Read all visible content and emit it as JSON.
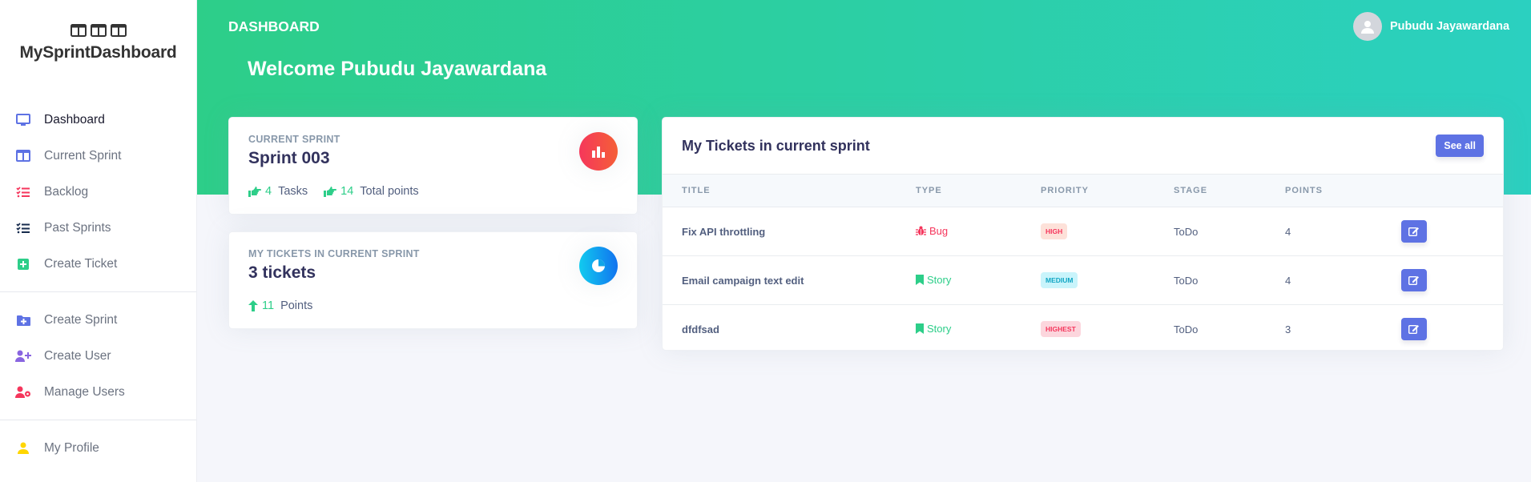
{
  "brand": {
    "name": "MySprintDashboard"
  },
  "sidebar": {
    "items": [
      {
        "label": "Dashboard",
        "icon": "monitor-icon",
        "color": "#5e72e4",
        "active": true
      },
      {
        "label": "Current Sprint",
        "icon": "columns-icon",
        "color": "#5e72e4"
      },
      {
        "label": "Backlog",
        "icon": "tasks-icon",
        "color": "#f5365c"
      },
      {
        "label": "Past Sprints",
        "icon": "list-check-icon",
        "color": "#172b4d"
      },
      {
        "label": "Create Ticket",
        "icon": "plus-square-icon",
        "color": "#2dce89"
      },
      {
        "label": "Create Sprint",
        "icon": "folder-plus-icon",
        "color": "#5e72e4"
      },
      {
        "label": "Create User",
        "icon": "user-plus-icon",
        "color": "#8965e0"
      },
      {
        "label": "Manage Users",
        "icon": "user-cog-icon",
        "color": "#f5365c"
      },
      {
        "label": "My Profile",
        "icon": "user-icon",
        "color": "#ffd600"
      }
    ]
  },
  "header": {
    "title": "DASHBOARD",
    "welcome": "Welcome Pubudu Jayawardana",
    "user_name": "Pubudu Jayawardana"
  },
  "stats": {
    "current_sprint": {
      "label": "Current Sprint",
      "value": "Sprint 003",
      "tasks_count": "4",
      "tasks_label": "Tasks",
      "points_count": "14",
      "points_label": "Total points",
      "icon": "chart-bar-icon",
      "color": "#f5365c"
    },
    "my_tickets": {
      "label": "My tickets in current sprint",
      "value": "3 tickets",
      "points_count": "11",
      "points_label": "Points",
      "icon": "chart-pie-icon",
      "color": "#11cdef"
    }
  },
  "tickets": {
    "title": "My Tickets in current sprint",
    "see_all": "See all",
    "columns": [
      "TITLE",
      "TYPE",
      "PRIORITY",
      "STAGE",
      "POINTS"
    ],
    "rows": [
      {
        "title": "Fix API throttling",
        "type": "Bug",
        "type_color": "#f5365c",
        "priority": "HIGH",
        "priority_bg": "#fde1d9",
        "priority_color": "#f5365c",
        "stage": "ToDo",
        "points": "4"
      },
      {
        "title": "Email campaign text edit",
        "type": "Story",
        "type_color": "#2dce89",
        "priority": "MEDIUM",
        "priority_bg": "#c9f4fb",
        "priority_color": "#11a6c4",
        "stage": "ToDo",
        "points": "4"
      },
      {
        "title": "dfdfsad",
        "type": "Story",
        "type_color": "#2dce89",
        "priority": "HIGHEST",
        "priority_bg": "#fcd6dd",
        "priority_color": "#f5365c",
        "stage": "ToDo",
        "points": "3"
      }
    ]
  }
}
